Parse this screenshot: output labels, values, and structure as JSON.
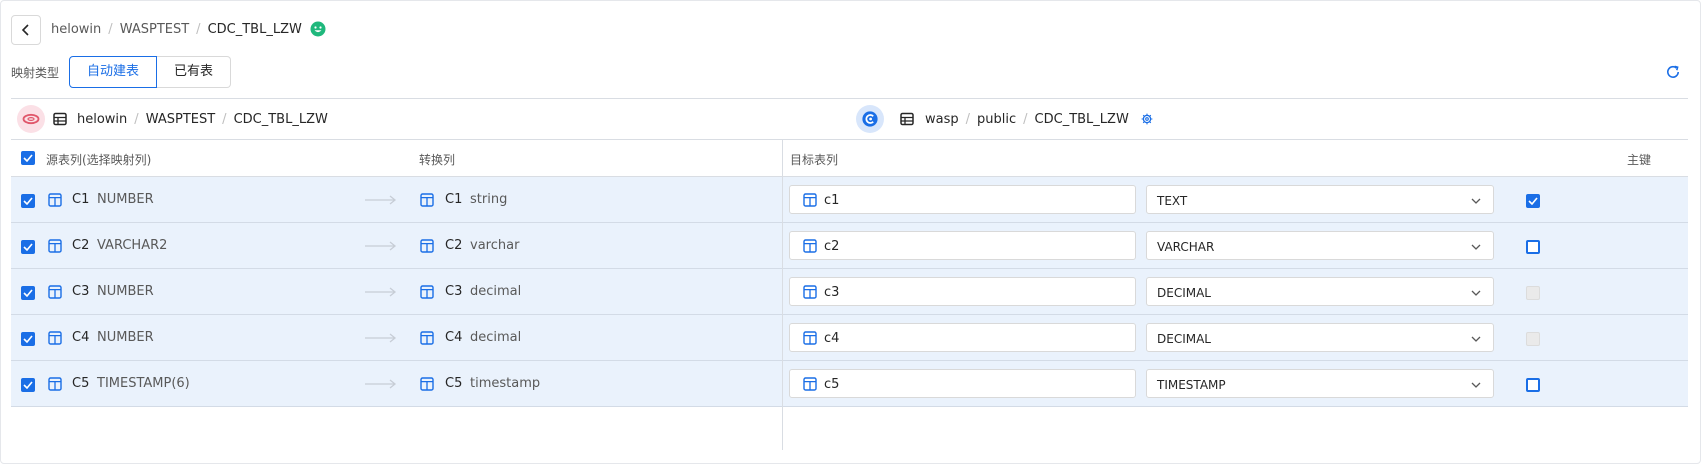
{
  "colors": {
    "accent": "#1a6ee6",
    "row_bg": "#eaf2fc"
  },
  "header": {
    "breadcrumb": [
      "helowin",
      "WASPTEST",
      "CDC_TBL_LZW"
    ],
    "back_icon": "chevron-left-icon",
    "status_icon": "smile-icon"
  },
  "mapping": {
    "label": "映射类型",
    "options": [
      "自动建表",
      "已有表"
    ],
    "selected": "自动建表"
  },
  "source": {
    "db_icon": "oracle-icon",
    "path": [
      "helowin",
      "WASPTEST",
      "CDC_TBL_LZW"
    ]
  },
  "target": {
    "db_icon": "postgres-icon",
    "path": [
      "wasp",
      "public",
      "CDC_TBL_LZW"
    ]
  },
  "columns": {
    "source": "源表列(选择映射列)",
    "convert": "转换列",
    "target": "目标表列",
    "pk": "主键"
  },
  "rows": [
    {
      "src_name": "C1",
      "src_type": "NUMBER",
      "conv_name": "C1",
      "conv_type": "string",
      "target_name": "c1",
      "target_type": "TEXT",
      "pk": "checked"
    },
    {
      "src_name": "C2",
      "src_type": "VARCHAR2",
      "conv_name": "C2",
      "conv_type": "varchar",
      "target_name": "c2",
      "target_type": "VARCHAR",
      "pk": "unchecked"
    },
    {
      "src_name": "C3",
      "src_type": "NUMBER",
      "conv_name": "C3",
      "conv_type": "decimal",
      "target_name": "c3",
      "target_type": "DECIMAL",
      "pk": "disabled"
    },
    {
      "src_name": "C4",
      "src_type": "NUMBER",
      "conv_name": "C4",
      "conv_type": "decimal",
      "target_name": "c4",
      "target_type": "DECIMAL",
      "pk": "disabled"
    },
    {
      "src_name": "C5",
      "src_type": "TIMESTAMP(6)",
      "conv_name": "C5",
      "conv_type": "timestamp",
      "target_name": "c5",
      "target_type": "TIMESTAMP",
      "pk": "unchecked"
    }
  ]
}
